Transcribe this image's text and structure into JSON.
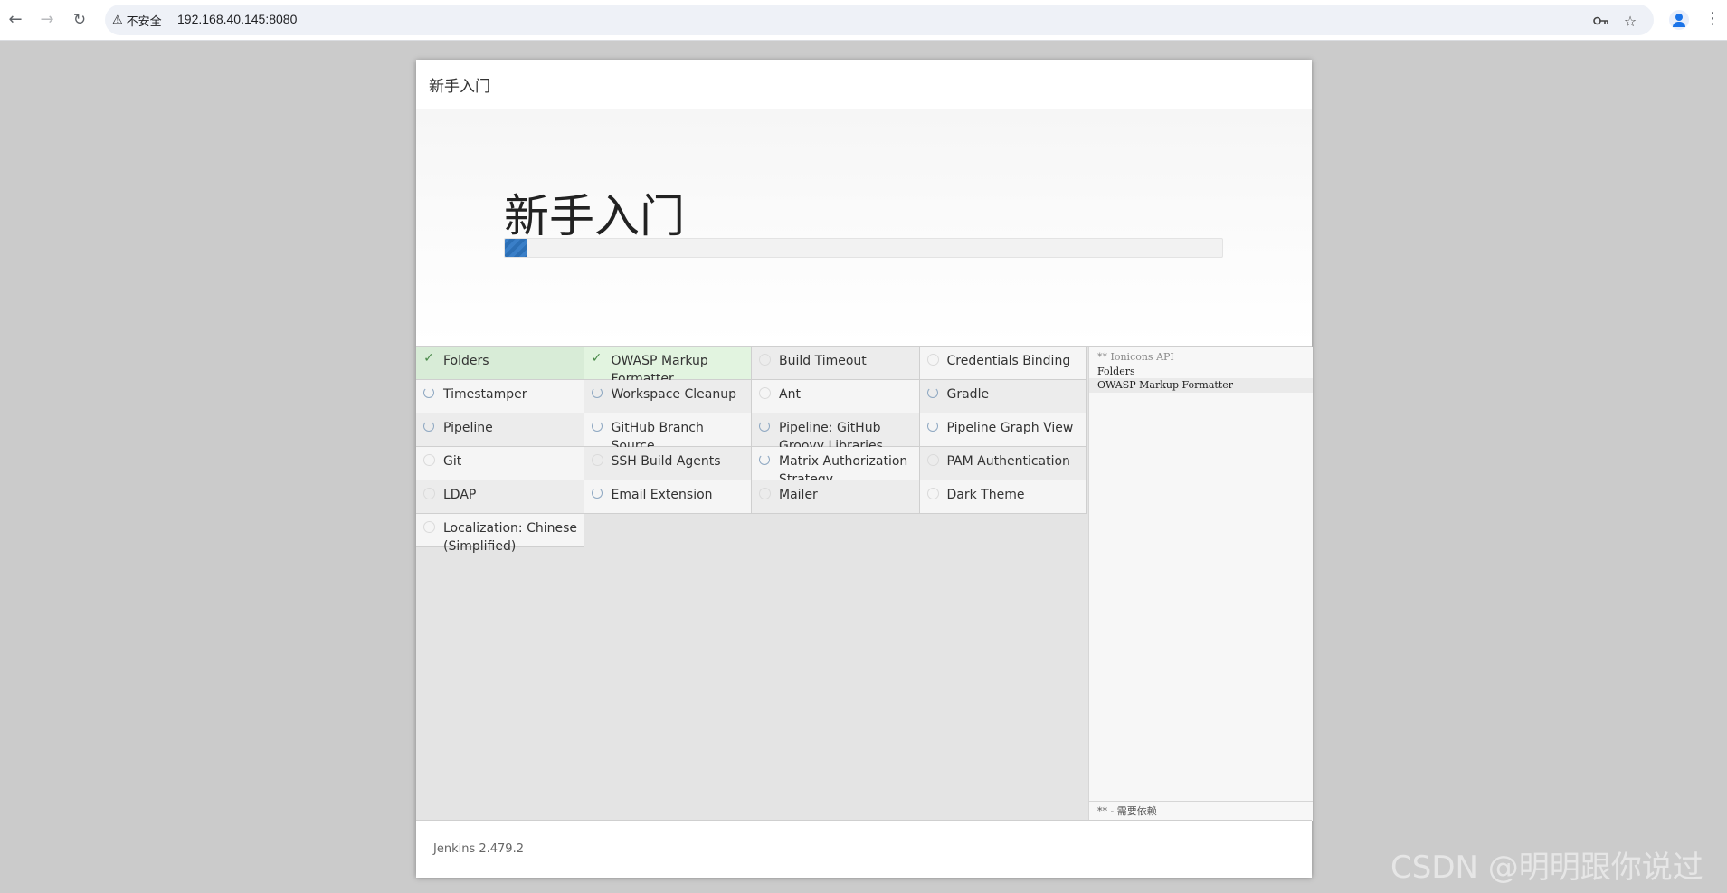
{
  "browser": {
    "security_label": "不安全",
    "url": "192.168.40.145:8080",
    "icons": {
      "back": "arrow-left-icon",
      "forward": "arrow-right-icon",
      "reload": "reload-icon",
      "warning": "warning-triangle-icon",
      "password": "key-icon",
      "bookmark": "star-icon",
      "profile": "person-icon",
      "menu": "more-vert-icon"
    }
  },
  "dialog": {
    "header_title": "新手入门",
    "hero_title": "新手入门",
    "progress_fraction": 0.03,
    "progress_color": "#2c6fb5"
  },
  "plugins": [
    {
      "name": "Folders",
      "status": "success"
    },
    {
      "name": "OWASP Markup Formatter",
      "status": "success"
    },
    {
      "name": "Build Timeout",
      "status": "pending"
    },
    {
      "name": "Credentials Binding",
      "status": "pending"
    },
    {
      "name": "Timestamper",
      "status": "installing"
    },
    {
      "name": "Workspace Cleanup",
      "status": "installing"
    },
    {
      "name": "Ant",
      "status": "pending"
    },
    {
      "name": "Gradle",
      "status": "installing"
    },
    {
      "name": "Pipeline",
      "status": "installing"
    },
    {
      "name": "GitHub Branch Source",
      "status": "installing"
    },
    {
      "name": "Pipeline: GitHub Groovy Libraries",
      "status": "installing"
    },
    {
      "name": "Pipeline Graph View",
      "status": "installing"
    },
    {
      "name": "Git",
      "status": "pending"
    },
    {
      "name": "SSH Build Agents",
      "status": "pending"
    },
    {
      "name": "Matrix Authorization Strategy",
      "status": "installing"
    },
    {
      "name": "PAM Authentication",
      "status": "pending"
    },
    {
      "name": "LDAP",
      "status": "pending"
    },
    {
      "name": "Email Extension",
      "status": "installing"
    },
    {
      "name": "Mailer",
      "status": "pending"
    },
    {
      "name": "Dark Theme",
      "status": "pending"
    },
    {
      "name": "Localization: Chinese (Simplified)",
      "status": "pending"
    }
  ],
  "log": {
    "lines": [
      {
        "text": "** Ionicons API",
        "style": "dim"
      },
      {
        "text": "Folders",
        "style": "normal"
      },
      {
        "text": "OWASP Markup Formatter",
        "style": "highlight"
      }
    ],
    "footer": "** - 需要依赖"
  },
  "footer": {
    "version": "Jenkins 2.479.2"
  },
  "watermark": "CSDN @明明跟你说过"
}
